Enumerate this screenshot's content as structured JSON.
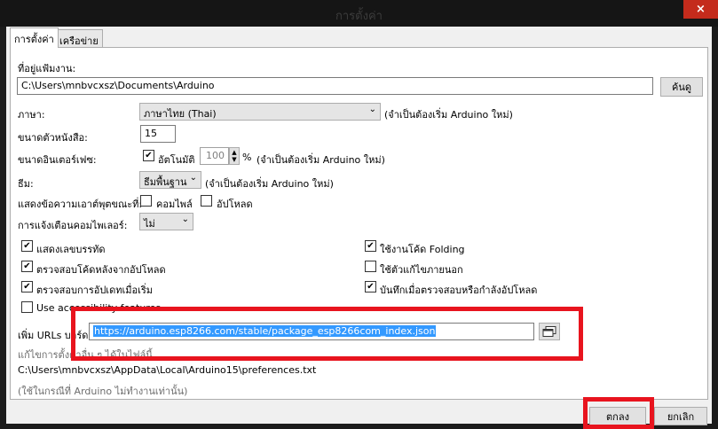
{
  "window": {
    "title": "การตั้งค่า",
    "close_icon": "×"
  },
  "tabs": [
    {
      "label": "การตั้งค่า",
      "active": true
    },
    {
      "label": "เครือข่าย",
      "active": false
    }
  ],
  "sketchbook": {
    "label": "ที่อยู่แฟ้มงาน:",
    "value": "C:\\Users\\mnbvcxsz\\Documents\\Arduino",
    "browse_label": "ค้นดู"
  },
  "language": {
    "label": "ภาษา:",
    "value": "ภาษาไทย (Thai)",
    "note": "(จำเป็นต้องเริ่ม Arduino ใหม่)"
  },
  "editor_font": {
    "label": "ขนาดตัวหนังสือ:",
    "value": "15"
  },
  "interface_scale": {
    "label": "ขนาดอินเตอร์เฟซ:",
    "auto_label": "อัตโนมัติ",
    "auto_checked": true,
    "value": "100",
    "unit": "%",
    "note": "(จำเป็นต้องเริ่ม Arduino ใหม่)"
  },
  "theme": {
    "label": "ธีม:",
    "value": "ธีมพื้นฐาน",
    "note": "(จำเป็นต้องเริ่ม Arduino ใหม่)"
  },
  "verbose": {
    "label": "แสดงข้อความเอาต์พุตขณะที่:",
    "compile_label": "คอมไพล์",
    "compile_checked": false,
    "upload_label": "อัปโหลด",
    "upload_checked": false
  },
  "compiler_warnings": {
    "label": "การแจ้งเตือนคอมไพเลอร์:",
    "value": "ไม่"
  },
  "options_left": [
    {
      "label": "แสดงเลขบรรทัด",
      "checked": true
    },
    {
      "label": "ตรวจสอบโค้ดหลังจากอัปโหลด",
      "checked": true
    },
    {
      "label": "ตรวจสอบการอัปเดทเมื่อเริ่ม",
      "checked": true
    },
    {
      "label": "Use accessibility features",
      "checked": false
    }
  ],
  "options_right": [
    {
      "label": "ใช้งานโค้ด Folding",
      "checked": true
    },
    {
      "label": "ใช้ตัวแก้ไขภายนอก",
      "checked": false
    },
    {
      "label": "บันทึกเมื่อตรวจสอบหรือกำลังอัปโหลด",
      "checked": true
    }
  ],
  "board_urls": {
    "label": "เพิ่ม URLs บอร์ด:",
    "value": "https://arduino.esp8266.com/stable/package_esp8266com_index.json",
    "window_icon": "window-icon"
  },
  "footer": {
    "edit_hint": "แก้ไขการตั้งค่าอื่น ๆ ได้ในไฟล์นี้",
    "prefs_path": "C:\\Users\\mnbvcxsz\\AppData\\Local\\Arduino15\\preferences.txt",
    "note": "(ใช้ในกรณีที่ Arduino ไม่ทำงานเท่านั้น)"
  },
  "buttons": {
    "ok_label": "ตกลง",
    "cancel_label": "ยกเลิก"
  },
  "annotation_color": "#e8141e"
}
